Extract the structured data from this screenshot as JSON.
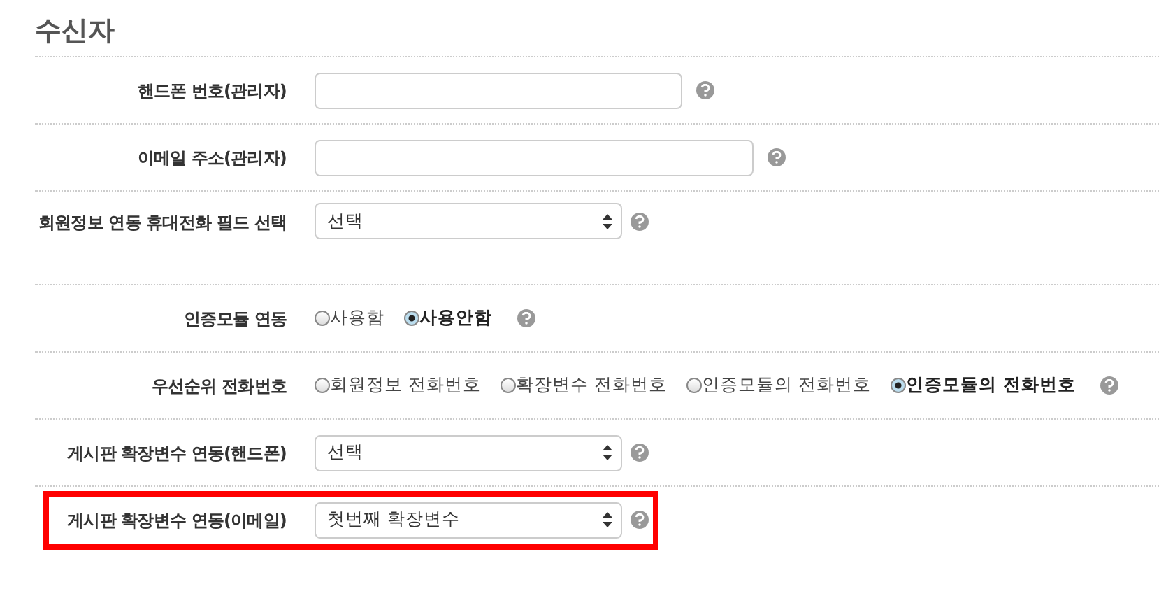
{
  "section": {
    "title": "수신자"
  },
  "rows": [
    {
      "kind": "short_text",
      "label": "핸드폰 번호(관리자)",
      "highlighted": false
    },
    {
      "kind": "long_text",
      "label": "이메일 주소(관리자)",
      "highlighted": false
    },
    {
      "kind": "select",
      "label": "회원정보 연동 휴대전화 필드 선택",
      "value": "선택",
      "highlighted": false
    },
    {
      "kind": "radio",
      "label": "인증모듈 연동",
      "options": [
        {
          "label": "사용함",
          "selected": false
        },
        {
          "label": "사용안함",
          "selected": true
        }
      ],
      "highlighted": false
    },
    {
      "kind": "radio",
      "label": "우선순위 전화번호",
      "options": [
        {
          "label": "회원정보 전화번호",
          "selected": false
        },
        {
          "label": "확장변수 전화번호",
          "selected": false
        },
        {
          "label": "인증모듈의 전화번호",
          "selected": false
        },
        {
          "label": "인증모듈의 전화번호",
          "selected": true
        }
      ],
      "highlighted": false
    },
    {
      "kind": "select",
      "label": "게시판 확장변수 연동(핸드폰)",
      "value": "선택",
      "highlighted": false
    },
    {
      "kind": "select",
      "label": "게시판 확장변수 연동(이메일)",
      "value": "첫번째 확장변수",
      "highlighted": true
    }
  ]
}
